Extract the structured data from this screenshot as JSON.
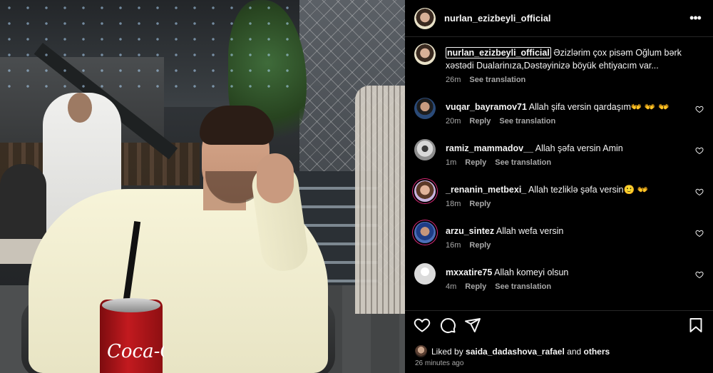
{
  "post": {
    "author": "nurlan_ezizbeyli_official",
    "more_icon": "more-horizontal-icon"
  },
  "photo": {
    "can_text": "Coca-Cola"
  },
  "caption": {
    "username": "nurlan_ezizbeyli_official",
    "text": "Əzizlərim çox pisəm Oğlum bərk xəstədi Dualarinıza,Dəstəyinizə böyük ehtiyacım var...",
    "time": "26m",
    "see_translation": "See translation"
  },
  "comments": [
    {
      "username": "vuqar_bayramov71",
      "text": "Allah şifa versin qardaşım👐 👐 👐",
      "time": "20m",
      "reply": "Reply",
      "see_translation": "See translation"
    },
    {
      "username": "ramiz_mammadov__",
      "text": "Allah şəfa versin Amin",
      "time": "1m",
      "reply": "Reply",
      "see_translation": "See translation"
    },
    {
      "username": "_renanin_metbexi_",
      "text": "Allah tezliklə şəfa versin🙂 👐",
      "time": "18m",
      "reply": "Reply",
      "see_translation": ""
    },
    {
      "username": "arzu_sintez",
      "text": "Allah wefa versin",
      "time": "16m",
      "reply": "Reply",
      "see_translation": ""
    },
    {
      "username": "mxxatire75",
      "text": "Allah komeyi olsun",
      "time": "4m",
      "reply": "Reply",
      "see_translation": "See translation"
    }
  ],
  "actions": {
    "like_icon": "heart-icon",
    "comment_icon": "comment-icon",
    "share_icon": "send-icon",
    "save_icon": "bookmark-icon"
  },
  "likes": {
    "prefix": "Liked by",
    "user": "saida_dadashova_rafael",
    "and": "and",
    "others": "others"
  },
  "posted_time": "26 minutes ago",
  "colors": {
    "background": "#000000",
    "text": "#f5f5f5",
    "secondary_text": "#a8a8a8",
    "divider": "#262626",
    "story_ring": "#d62976"
  }
}
